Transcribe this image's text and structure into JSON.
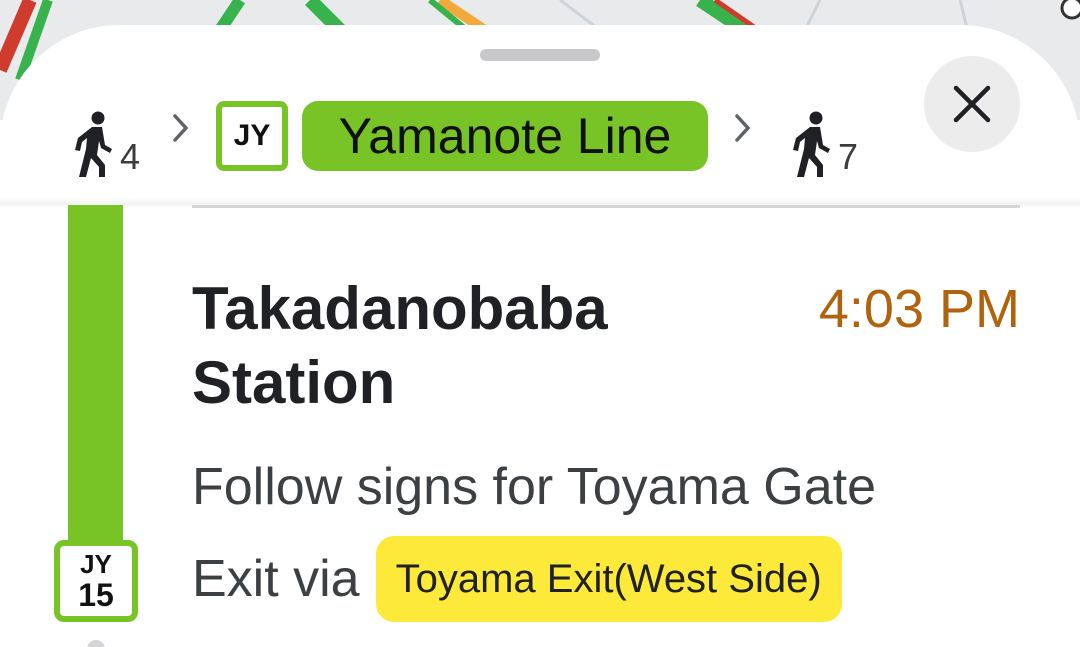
{
  "route": {
    "walk_start_minutes": "4",
    "walk_end_minutes": "7",
    "line_code": "JY",
    "line_name": "Yamanote Line",
    "line_color": "#78c427"
  },
  "step": {
    "station_name": "Takadanobaba Station",
    "arrival_time": "4:03 PM",
    "arrival_time_color": "#b0620c",
    "instruction": "Follow signs for Toyama Gate",
    "exit_prefix": "Exit via",
    "exit_name": "Toyama Exit(West Side)",
    "exit_highlight_color": "#fde939",
    "station_code": "JY",
    "station_number": "15"
  },
  "icons": {
    "walk": "walking-person-icon",
    "chevron": "chevron-right-icon",
    "close": "close-icon"
  }
}
